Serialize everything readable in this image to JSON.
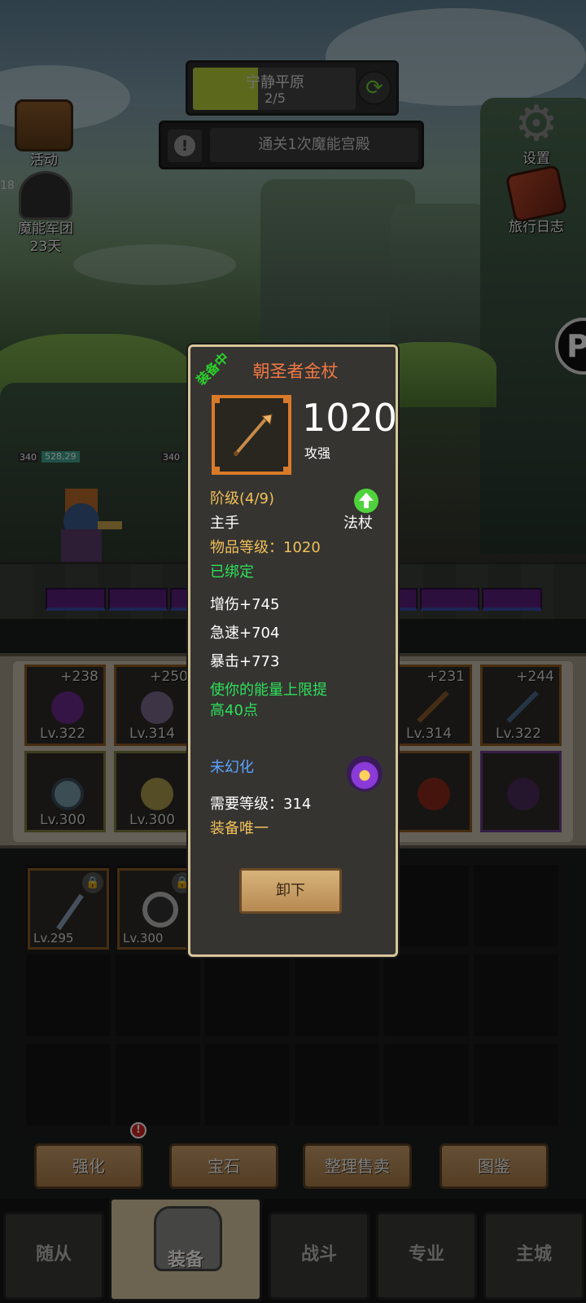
{
  "stage": {
    "name": "宁静平原",
    "progress_text": "2/5",
    "progress": 0.4
  },
  "quest": {
    "text": "通关1次魔能宫殿"
  },
  "left_menu": [
    {
      "label": "活动"
    },
    {
      "label": "魔能军团",
      "sub": "23天",
      "corner": "18"
    }
  ],
  "right_menu": [
    {
      "label": "设置"
    },
    {
      "label": "旅行日志"
    }
  ],
  "battle": {
    "ally": {
      "level": "340",
      "hp": "528,29"
    },
    "enemy": {
      "level": "340"
    }
  },
  "equip_slots_row1": [
    {
      "plus": "+238",
      "lv": "Lv.322"
    },
    {
      "plus": "+250",
      "lv": "Lv.314"
    },
    {
      "plus": "+231",
      "lv": "Lv.314"
    },
    {
      "plus": "+244",
      "lv": "Lv.322"
    }
  ],
  "equip_slots_row2": [
    {
      "lv": "Lv.300"
    },
    {
      "lv": "Lv.300"
    }
  ],
  "bag_items": [
    {
      "lv": "Lv.295"
    },
    {
      "lv": "Lv.300"
    }
  ],
  "actions": {
    "enhance": "强化",
    "gem": "宝石",
    "sort_sell": "整理售卖",
    "codex": "图鉴",
    "enhance_badge": "!"
  },
  "nav": {
    "follower": "随从",
    "equipment": "装备",
    "battle": "战斗",
    "profession": "专业",
    "main_city": "主城"
  },
  "tooltip": {
    "equipped_tag": "装备中",
    "item_name": "朝圣者金杖",
    "power": "1020",
    "power_sub": "攻强",
    "tier": "阶级(4/9)",
    "slot": "主手",
    "weapon_type": "法杖",
    "item_level": "物品等级：1020",
    "bound": "已绑定",
    "stats": [
      "增伤+745",
      "急速+704",
      "暴击+773"
    ],
    "effect_line1": "使你的能量上限提",
    "effect_line2": "高40点",
    "illusion": "未幻化",
    "required_level": "需要等级：314",
    "unique": "装备唯一",
    "unequip_button": "卸下"
  },
  "colors": {
    "item_name": "#f07845",
    "gold_text": "#f0c05a",
    "green_text": "#2ee05a",
    "blue_text": "#5aa3ff",
    "stage_fill": "#b9d33a"
  }
}
